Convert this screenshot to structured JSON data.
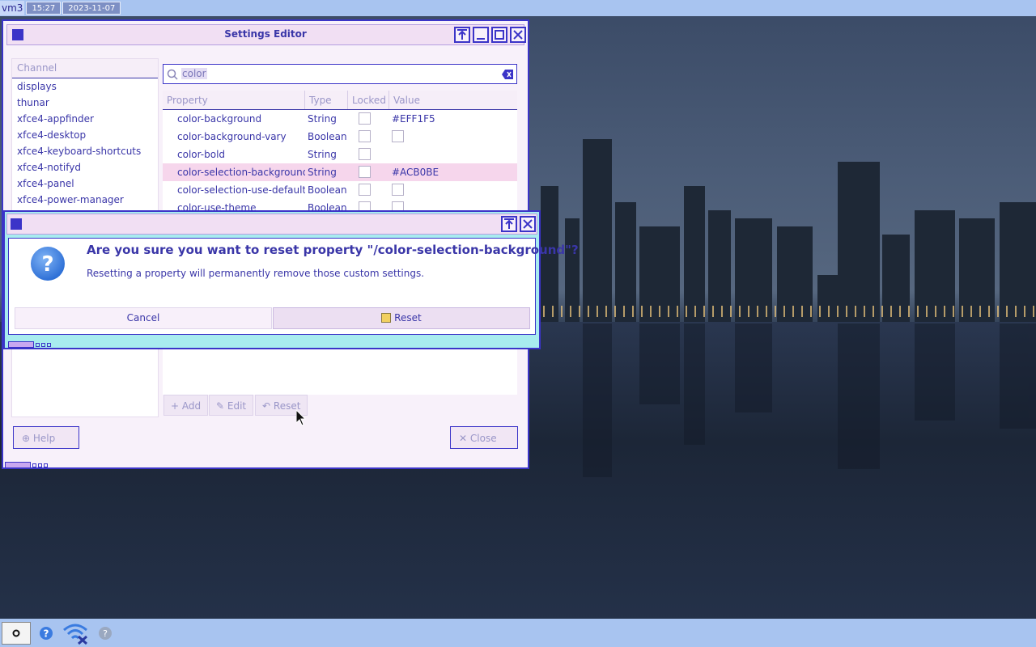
{
  "top_panel": {
    "workspace": "vm3",
    "time": "15:27",
    "date": "2023-11-07"
  },
  "settings_window": {
    "title": "Settings Editor",
    "channel_header": "Channel",
    "channels": [
      "displays",
      "thunar",
      "xfce4-appfinder",
      "xfce4-desktop",
      "xfce4-keyboard-shortcuts",
      "xfce4-notifyd",
      "xfce4-panel",
      "xfce4-power-manager"
    ],
    "search_value": "color",
    "columns": [
      "Property",
      "Type",
      "Locked",
      "Value"
    ],
    "rows": [
      {
        "property": "color-background",
        "type": "String",
        "value": "#EFF1F5",
        "value_is_checkbox": false
      },
      {
        "property": "color-background-vary",
        "type": "Boolean",
        "value": "",
        "value_is_checkbox": true
      },
      {
        "property": "color-bold",
        "type": "String",
        "value": "",
        "value_is_checkbox": false
      },
      {
        "property": "color-selection-background",
        "type": "String",
        "value": "#ACB0BE",
        "value_is_checkbox": false,
        "selected": true
      },
      {
        "property": "color-selection-use-default",
        "type": "Boolean",
        "value": "",
        "value_is_checkbox": true
      },
      {
        "property": "color-use-theme",
        "type": "Boolean",
        "value": "",
        "value_is_checkbox": true
      }
    ],
    "add_label": "Add",
    "edit_label": "Edit",
    "reset_label": "Reset",
    "help_label": "Help",
    "close_label": "Close"
  },
  "dialog": {
    "heading": "Are you sure you want to reset property \"/color-selection-background\"?",
    "text": "Resetting a property will permanently remove those custom settings.",
    "cancel_label": "Cancel",
    "reset_label": "Reset"
  },
  "colors": {
    "accent": "#3b34c8",
    "titlebar": "#f1dff3",
    "selection": "#f6d6ec",
    "panel": "#a8c4f0"
  }
}
